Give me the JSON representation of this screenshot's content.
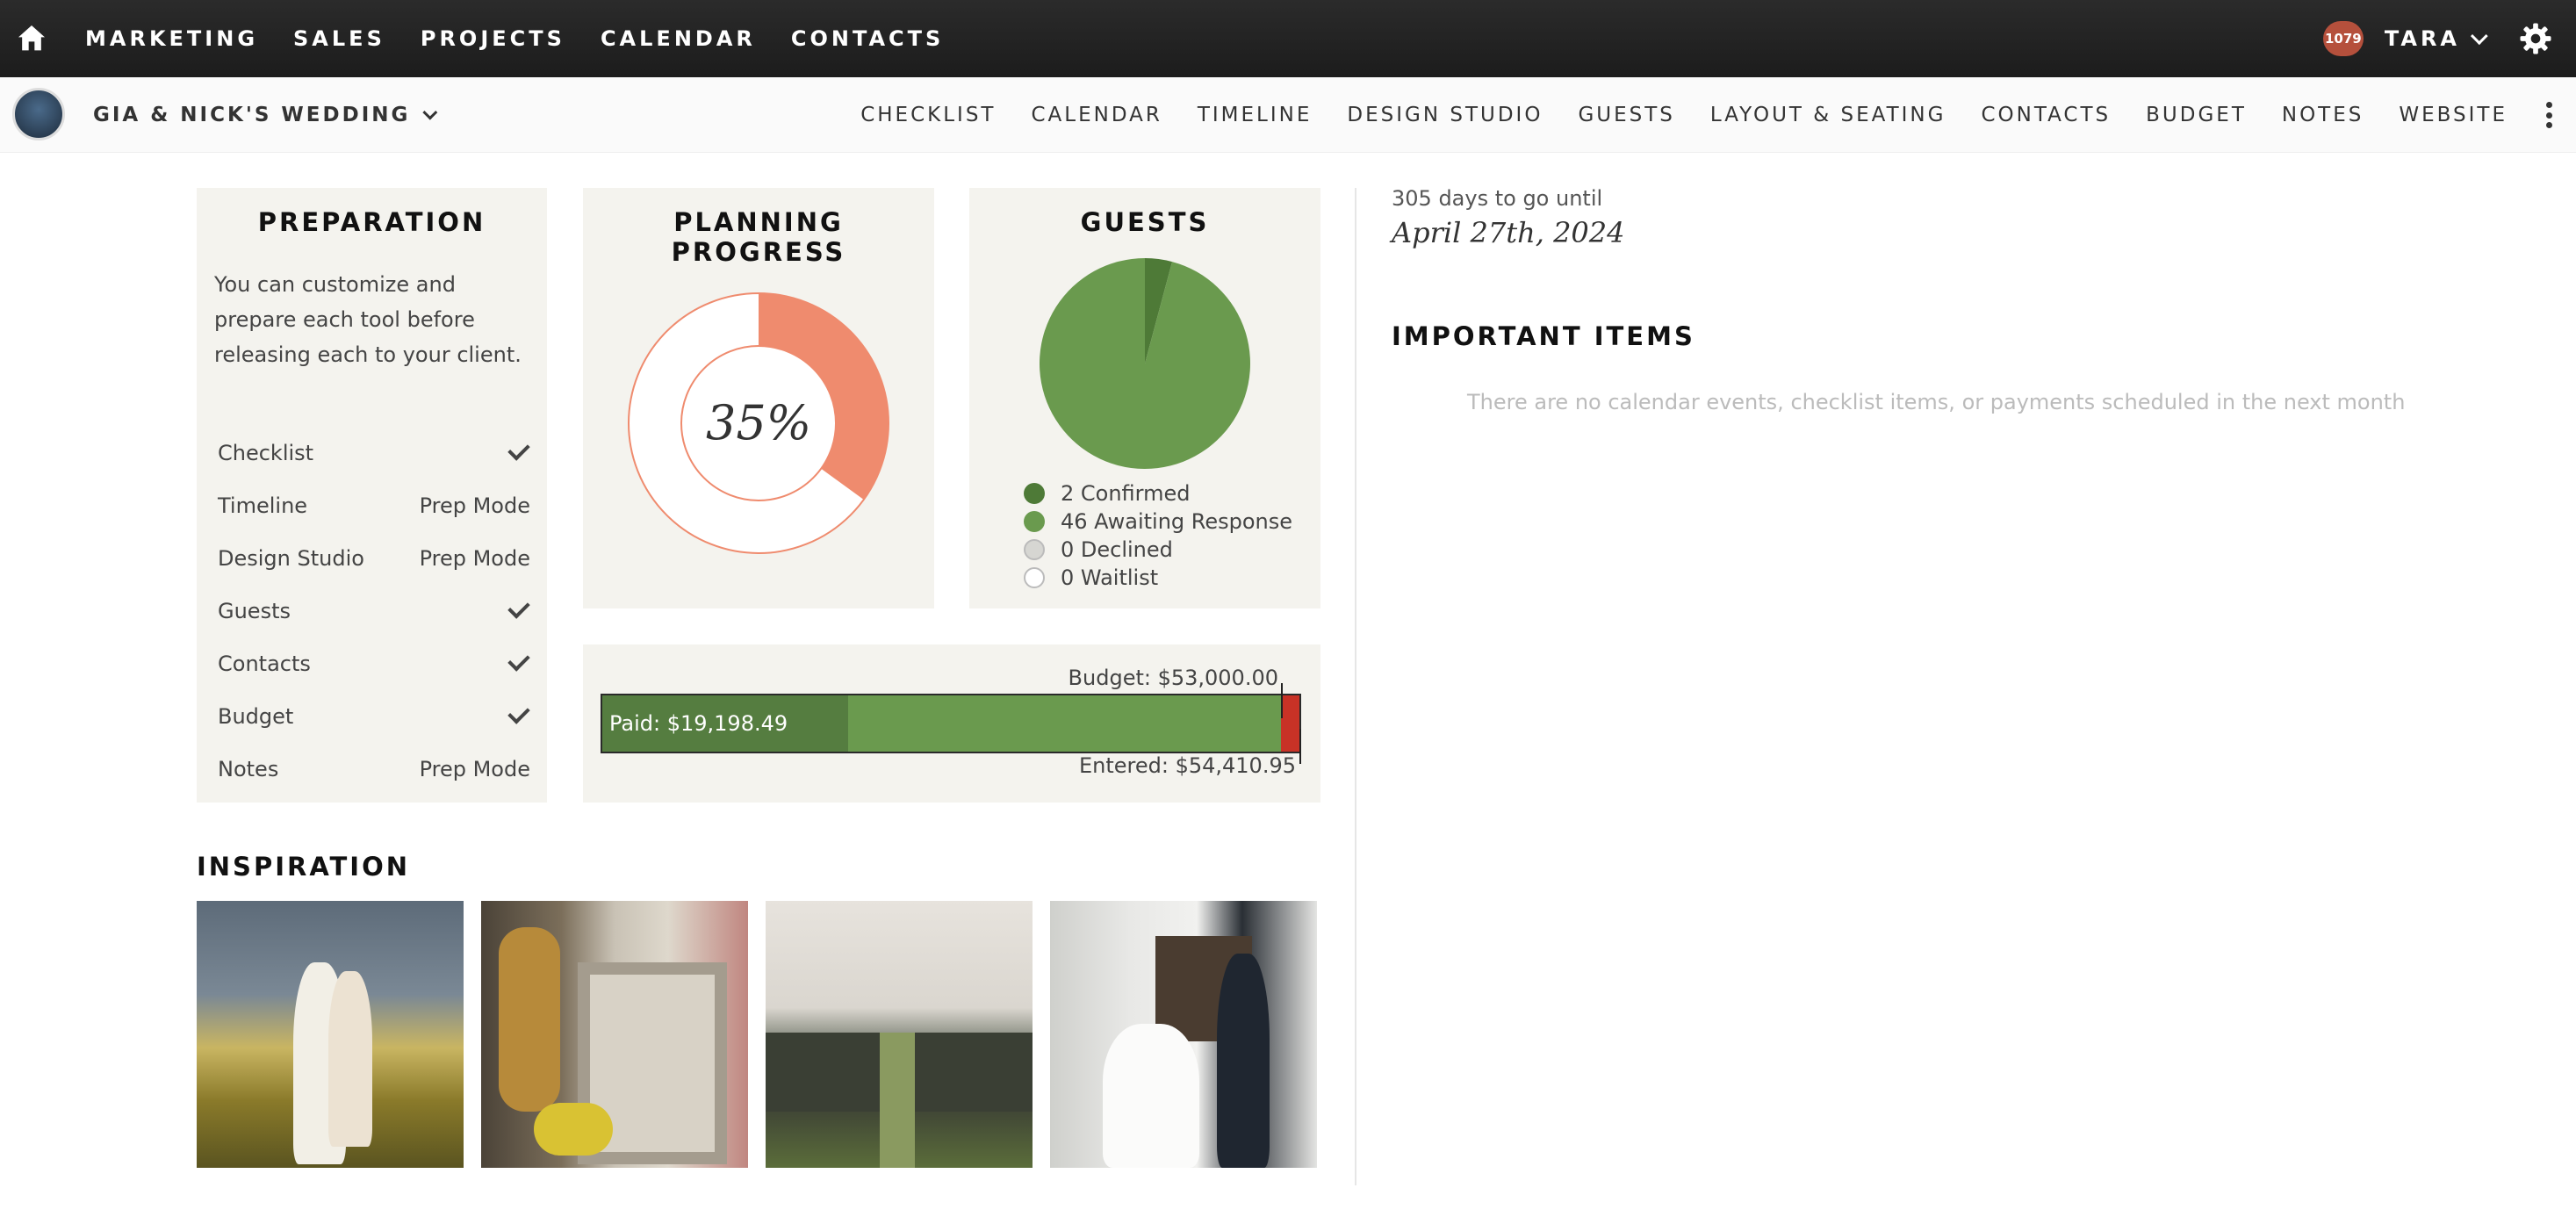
{
  "topnav": {
    "items": [
      "MARKETING",
      "SALES",
      "PROJECTS",
      "CALENDAR",
      "CONTACTS"
    ],
    "badge": "1079",
    "user": "TARA"
  },
  "subnav": {
    "project": "GIA & NICK'S WEDDING",
    "tabs": [
      "CHECKLIST",
      "CALENDAR",
      "TIMELINE",
      "DESIGN STUDIO",
      "GUESTS",
      "LAYOUT & SEATING",
      "CONTACTS",
      "BUDGET",
      "NOTES",
      "WEBSITE"
    ]
  },
  "preparation": {
    "title": "PREPARATION",
    "description": "You can customize and prepare each tool before releasing each to your client.",
    "rows": [
      {
        "label": "Checklist",
        "status": ""
      },
      {
        "label": "Timeline",
        "status": "Prep Mode"
      },
      {
        "label": "Design Studio",
        "status": "Prep Mode"
      },
      {
        "label": "Guests",
        "status": ""
      },
      {
        "label": "Contacts",
        "status": ""
      },
      {
        "label": "Budget",
        "status": ""
      },
      {
        "label": "Notes",
        "status": "Prep Mode"
      }
    ]
  },
  "planning": {
    "title": "PLANNING PROGRESS",
    "percent_label": "35%",
    "percent": 35,
    "color": "#ef8b6e"
  },
  "guests": {
    "title": "GUESTS",
    "legend": [
      "2 Confirmed",
      "46 Awaiting Response",
      "0 Declined",
      "0 Waitlist"
    ],
    "counts": [
      2,
      46,
      0,
      0
    ],
    "colors": [
      "#4e7a37",
      "#6a9a4e",
      "#d6d6d2",
      "#ffffff"
    ]
  },
  "budget": {
    "budget_label": "Budget: $53,000.00",
    "entered_label": "Entered: $54,410.95",
    "paid_label": "Paid: $19,198.49",
    "paid": 19198.49,
    "budget": 53000.0,
    "entered": 54410.95
  },
  "countdown": {
    "days_text": "305 days to go until",
    "date": "April 27th, 2024"
  },
  "important": {
    "title": "IMPORTANT ITEMS",
    "empty": "There are no calendar events, checklist items, or payments scheduled in the next month"
  },
  "inspiration": {
    "title": "INSPIRATION"
  }
}
